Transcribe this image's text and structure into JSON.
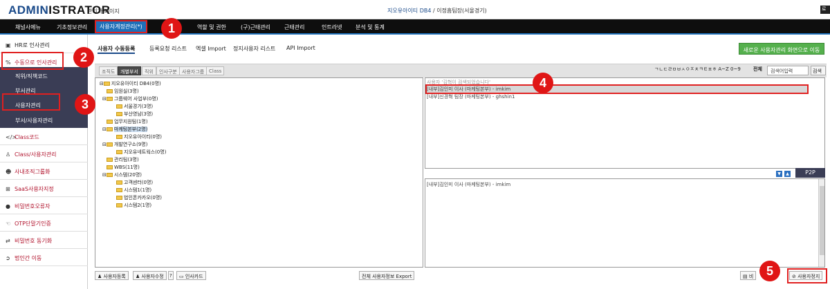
{
  "header": {
    "logo_a": "ADMIN",
    "logo_b": "ISTRATOR",
    "subtitle": "관리자 페이지",
    "company": "지오유아이티 DB4",
    "user": "/ 이정흠팀장(서울경기)",
    "logout": "로그"
  },
  "nav": [
    "채널사메뉴",
    "기초정보관리",
    "사용자계정관리(*)",
    "역할 및 권한",
    "(구)근태관리",
    "근태관리",
    "인트라넷",
    "분석 및 통계"
  ],
  "sidebar": {
    "items": [
      "HR로 인사관리",
      "수동으로 인사관리"
    ],
    "sub": [
      "직위/직책코드",
      "부서관리",
      "사용자관리",
      "부서/사용자관리"
    ],
    "more": [
      "Class코드",
      "Class/사용자관리",
      "사내조직그룹화",
      "SaaS사용자지정",
      "비밀번호오류자",
      "OTP단말기인증",
      "비밀번호 동기화",
      "법인간 이동"
    ]
  },
  "tabs": [
    "사용자 수동등록",
    "등록요청 리스트",
    "엑셀 Import",
    "정지사용자 리스트",
    "API Import"
  ],
  "new_button": "새로운 사용자관리 화면으로 이동",
  "subtabs": [
    "조직도",
    "개별부서",
    "직위",
    "인사구분",
    "사용자그룹",
    "Class"
  ],
  "search": {
    "letters": "ㄱㄴㄷㄹㅁㅂㅅㅇㅈㅊㅋㅌㅍㅎ A~Z 0~9",
    "all": "전체",
    "placeholder": "검색어입력",
    "button": "검색"
  },
  "tree": [
    "지오유아이티 DB4(0명)",
    "임원실(3명)",
    "그룹웨어 사업부(0명)",
    "서울경기(3명)",
    "부산영남(3명)",
    "업무지원팀(1명)",
    "마케팅본부(2명)",
    "지오유아이티(0명)",
    "개발연구소(9명)",
    "지오유네트웍스(0명)",
    "관리팀(3명)",
    "WBS(11명)",
    "시스템(20명)",
    "고객센터(0명)",
    "시스템1(1명)",
    "법인폰카카오(0명)",
    "시스템2(1명)"
  ],
  "users": {
    "hint": "사용자 '김혁이 검색되었습니다'",
    "list": [
      "[내부]김인미 이사 (마케팅본부) - imkim",
      "[내부]신경혁 팀장 (마케팅본부) - ghshin1"
    ],
    "selected": "[내부]김인미 이사 (마케팅본부) - imkim",
    "p2p": "P2P"
  },
  "bottom": [
    "사용자등록",
    "사용자수정",
    "인사카드",
    "전체 사용자정보 Export",
    "비",
    "사용자정지"
  ],
  "badges": [
    "1",
    "2",
    "3",
    "4",
    "5"
  ]
}
